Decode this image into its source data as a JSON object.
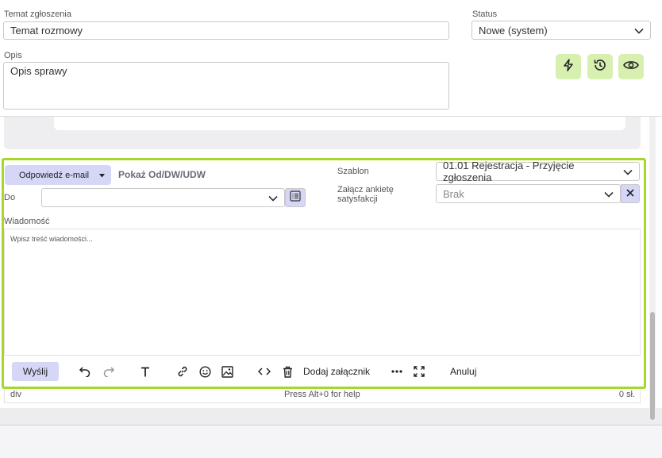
{
  "case": {
    "topic_label": "Temat zgłoszenia",
    "topic_value": "Temat rozmowy",
    "status_label": "Status",
    "status_value": "Nowe (system)",
    "description_label": "Opis",
    "description_value": "Opis sprawy"
  },
  "reply": {
    "mode_button": "Odpowiedź e-mail",
    "show_from_link": "Pokaż Od/DW/UDW",
    "to_label": "Do",
    "to_value": "",
    "template_label": "Szablon",
    "template_value": "01.01 Rejestracja - Przyjęcie zgłoszenia",
    "survey_label": "Załącz ankietę satysfakcji",
    "survey_value": "Brak",
    "message_label": "Wiadomość",
    "message_placeholder": "Wpisz treść wiadomości..."
  },
  "toolbar": {
    "send_label": "Wyślij",
    "add_attachment_label": "Dodaj załącznik",
    "cancel_label": "Anuluj"
  },
  "statusbar": {
    "element_path": "div",
    "help_hint": "Press Alt+0 for help",
    "word_count": "0 sł."
  },
  "colors": {
    "accent_green": "#a5d82a",
    "icon_button_bg": "#d7f0b0",
    "reply_button_bg": "#d6d6f7",
    "link_gray": "#6a6a7a"
  }
}
